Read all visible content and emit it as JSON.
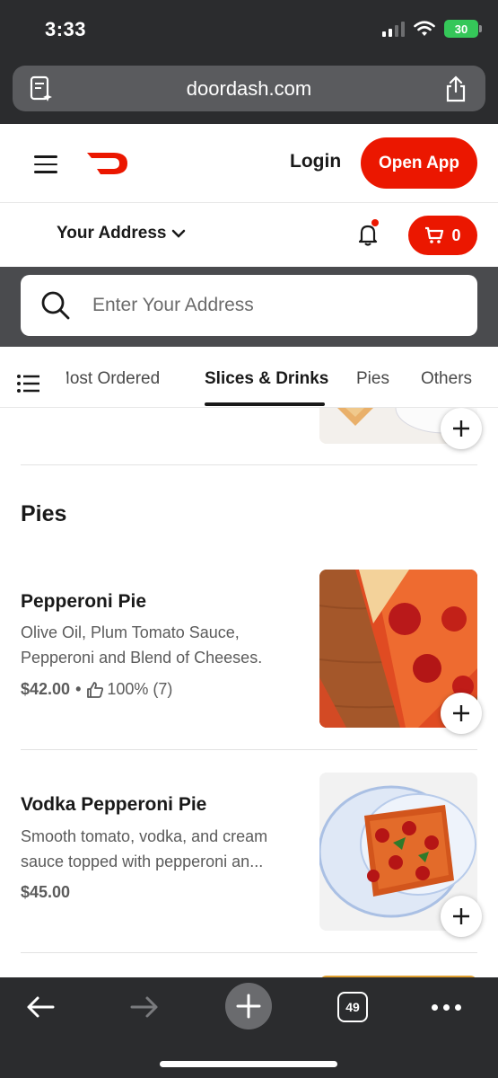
{
  "status_bar": {
    "time": "3:33",
    "battery": "30"
  },
  "browser": {
    "url": "doordash.com"
  },
  "header": {
    "login_label": "Login",
    "open_app_label": "Open App"
  },
  "address_row": {
    "address_label": "Your Address",
    "cart_count": "0"
  },
  "search": {
    "placeholder": "Enter Your Address"
  },
  "tabs": [
    {
      "label": "Most Ordered"
    },
    {
      "label": "Slices & Drinks"
    },
    {
      "label": "Pies"
    },
    {
      "label": "Others"
    }
  ],
  "active_tab": "Slices & Drinks",
  "section": {
    "title": "Pies"
  },
  "items": [
    {
      "name": "Pepperoni Pie",
      "description": "Olive Oil, Plum Tomato Sauce, Pepperoni and Blend of Cheeses.",
      "price": "$42.00",
      "rating": "100% (7)"
    },
    {
      "name": "Vodka Pepperoni Pie",
      "description": "Smooth tomato, vodka, and cream sauce topped with pepperoni an...",
      "price": "$45.00"
    }
  ],
  "bottom_bar": {
    "tab_count": "49"
  },
  "colors": {
    "brand": "#eb1700",
    "chrome": "#2b2c2e",
    "text": "#191919",
    "muted": "#5b5b5b"
  },
  "icons": [
    "hamburger-icon",
    "doordash-logo",
    "chevron-down-icon",
    "bell-icon",
    "cart-icon",
    "search-icon",
    "list-icon",
    "thumbs-up-icon",
    "plus-icon",
    "back-icon",
    "forward-icon",
    "tabs-icon",
    "more-icon",
    "share-icon",
    "reader-icon"
  ]
}
